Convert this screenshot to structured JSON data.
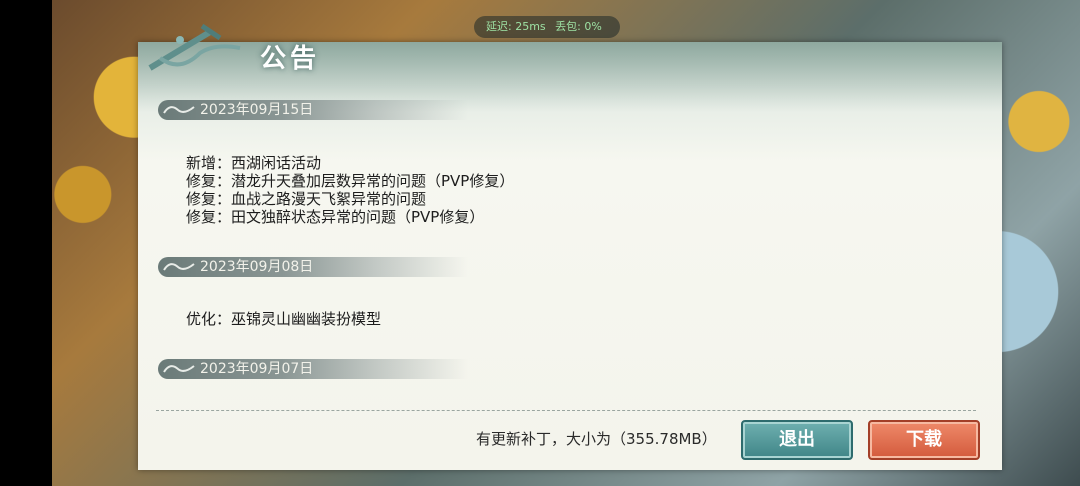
{
  "network": {
    "latency": "延迟: 25ms",
    "loss": "丢包: 0%"
  },
  "dialog": {
    "title": "公告",
    "sections": [
      {
        "date": "2023年09月15日",
        "lines": [
          "新增：西湖闲话活动",
          "修复：潜龙升天叠加层数异常的问题（PVP修复）",
          "修复：血战之路漫天飞絮异常的问题",
          "修复：田文独醉状态异常的问题（PVP修复）"
        ]
      },
      {
        "date": "2023年09月08日",
        "lines": [
          "优化：巫锦灵山幽幽装扮模型"
        ]
      },
      {
        "date": "2023年09月07日",
        "lines": []
      }
    ],
    "patch_info": "有更新补丁，大小为（355.78MB）",
    "exit_label": "退出",
    "download_label": "下载"
  },
  "colors": {
    "exit_button": "#3f8587",
    "download_button": "#d35a3c"
  }
}
